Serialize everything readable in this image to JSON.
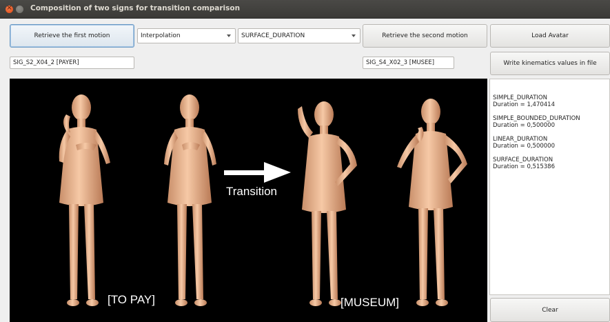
{
  "window": {
    "title": "Composition of two signs for transition comparison"
  },
  "toolbar": {
    "retrieve_first": "Retrieve the first motion",
    "method_select": "Interpolation",
    "duration_select": "SURFACE_DURATION",
    "retrieve_second": "Retrieve the second motion",
    "load_avatar": "Load Avatar",
    "write_kinematics": "Write kinematics values in file",
    "clear": "Clear"
  },
  "fields": {
    "first_sign": "SIG_S2_X04_2 [PAYER]",
    "second_sign": "SIG_S4_X02_3 [MUSEE]"
  },
  "viewport": {
    "label_first": "[TO PAY]",
    "label_transition": "Transition",
    "label_second": "[MUSEUM]"
  },
  "durations": [
    {
      "name": "SIMPLE_DURATION",
      "value": "Duration  = 1,470414"
    },
    {
      "name": "SIMPLE_BOUNDED_DURATION",
      "value": "Duration  = 0,500000"
    },
    {
      "name": "LINEAR_DURATION",
      "value": "Duration  = 0,500000"
    },
    {
      "name": "SURFACE_DURATION",
      "value": "Duration  = 0,515386"
    }
  ]
}
